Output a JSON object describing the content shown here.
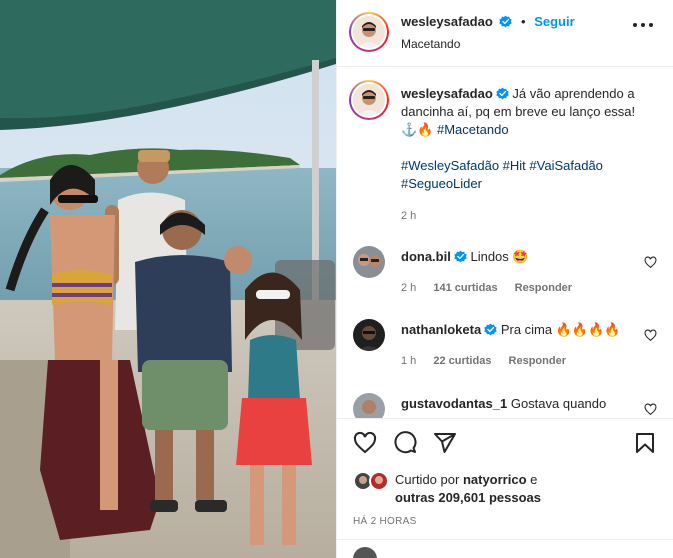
{
  "post": {
    "author": "wesleysafadao",
    "follow_label": "Seguir",
    "dot": "•",
    "location": "Macetando"
  },
  "caption": {
    "author": "wesleysafadao",
    "text": "Já vão aprendendo a dancinha aí, pq em breve eu lanço essa! ⚓🔥",
    "tag_inline": "#Macetando",
    "hashtags_line1": [
      "#WesleySafadão",
      "#Hit",
      "#VaiSafadão"
    ],
    "hashtags_line2": [
      "#SegueoLider"
    ],
    "time": "2 h"
  },
  "comments": [
    {
      "user": "dona.bil",
      "text": "Lindos 🤩",
      "time": "2 h",
      "likes": "141 curtidas",
      "reply": "Responder"
    },
    {
      "user": "nathanloketa",
      "text": "Pra cima 🔥🔥🔥🔥",
      "time": "1 h",
      "likes": "22 curtidas",
      "reply": "Responder"
    },
    {
      "user": "gustavodantas_1",
      "text": "Gostava quando"
    }
  ],
  "likes": {
    "prefix": "Curtido por",
    "user": "natyorrico",
    "connector": "e",
    "others": "outras 209,601 pessoas"
  },
  "posted_ago": "HÁ 2 HORAS",
  "icons": {
    "like": "heart-icon",
    "comment": "comment-icon",
    "share": "share-icon",
    "save": "bookmark-icon",
    "verified": "verified-badge-icon",
    "more": "more-options-icon"
  },
  "colors": {
    "accent": "#0095f6",
    "verified": "#0095f6",
    "hashtag": "#00376b",
    "muted": "#737373"
  }
}
